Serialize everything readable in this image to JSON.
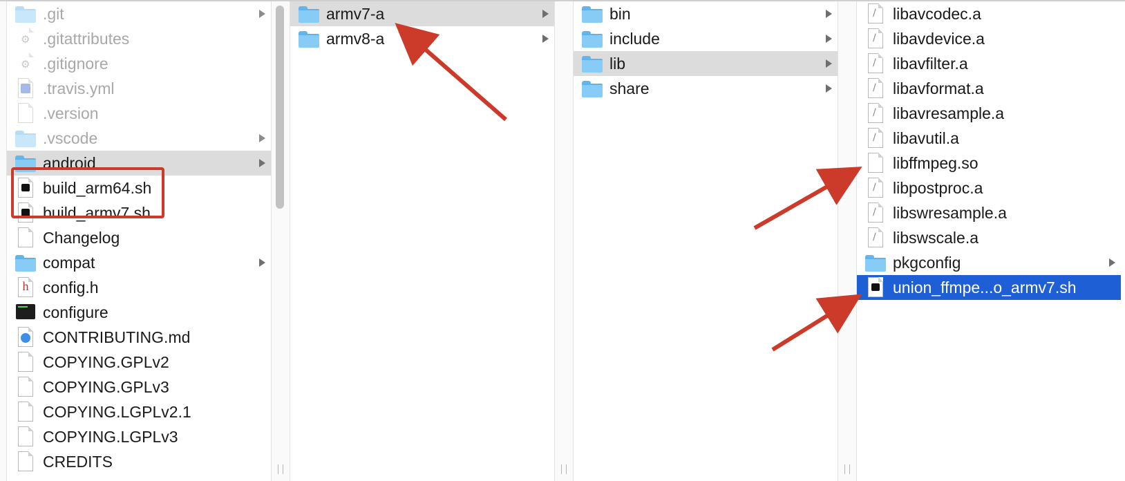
{
  "columns": [
    {
      "items": [
        {
          "label": ".git",
          "icon": "folder-icon",
          "has_children": true,
          "dim": true
        },
        {
          "label": ".gitattributes",
          "icon": "gear-file-icon",
          "has_children": false,
          "dim": true
        },
        {
          "label": ".gitignore",
          "icon": "gear-file-icon",
          "has_children": false,
          "dim": true
        },
        {
          "label": ".travis.yml",
          "icon": "yml-file-icon",
          "has_children": false,
          "dim": true
        },
        {
          "label": ".version",
          "icon": "document-icon",
          "has_children": false,
          "dim": true
        },
        {
          "label": ".vscode",
          "icon": "folder-icon",
          "has_children": true,
          "dim": true
        },
        {
          "label": "android",
          "icon": "folder-icon",
          "has_children": true,
          "selected": "gray"
        },
        {
          "label": "build_arm64.sh",
          "icon": "shell-script-icon",
          "has_children": false
        },
        {
          "label": "build_armv7.sh",
          "icon": "shell-script-icon",
          "has_children": false
        },
        {
          "label": "Changelog",
          "icon": "document-icon",
          "has_children": false
        },
        {
          "label": "compat",
          "icon": "folder-icon",
          "has_children": true
        },
        {
          "label": "config.h",
          "icon": "header-file-icon",
          "has_children": false
        },
        {
          "label": "configure",
          "icon": "terminal-exec-icon",
          "has_children": false
        },
        {
          "label": "CONTRIBUTING.md",
          "icon": "markdown-file-icon",
          "has_children": false
        },
        {
          "label": "COPYING.GPLv2",
          "icon": "document-icon",
          "has_children": false
        },
        {
          "label": "COPYING.GPLv3",
          "icon": "document-icon",
          "has_children": false
        },
        {
          "label": "COPYING.LGPLv2.1",
          "icon": "document-icon",
          "has_children": false
        },
        {
          "label": "COPYING.LGPLv3",
          "icon": "document-icon",
          "has_children": false
        },
        {
          "label": "CREDITS",
          "icon": "document-icon",
          "has_children": false
        }
      ]
    },
    {
      "items": [
        {
          "label": "armv7-a",
          "icon": "folder-icon",
          "has_children": true,
          "selected": "gray"
        },
        {
          "label": "armv8-a",
          "icon": "folder-icon",
          "has_children": true
        }
      ]
    },
    {
      "items": [
        {
          "label": "bin",
          "icon": "folder-icon",
          "has_children": true
        },
        {
          "label": "include",
          "icon": "folder-icon",
          "has_children": true
        },
        {
          "label": "lib",
          "icon": "folder-icon",
          "has_children": true,
          "selected": "gray"
        },
        {
          "label": "share",
          "icon": "folder-icon",
          "has_children": true
        }
      ]
    },
    {
      "items": [
        {
          "label": "libavcodec.a",
          "icon": "archive-file-icon",
          "has_children": false
        },
        {
          "label": "libavdevice.a",
          "icon": "archive-file-icon",
          "has_children": false
        },
        {
          "label": "libavfilter.a",
          "icon": "archive-file-icon",
          "has_children": false
        },
        {
          "label": "libavformat.a",
          "icon": "archive-file-icon",
          "has_children": false
        },
        {
          "label": "libavresample.a",
          "icon": "archive-file-icon",
          "has_children": false
        },
        {
          "label": "libavutil.a",
          "icon": "archive-file-icon",
          "has_children": false
        },
        {
          "label": "libffmpeg.so",
          "icon": "document-icon",
          "has_children": false
        },
        {
          "label": "libpostproc.a",
          "icon": "archive-file-icon",
          "has_children": false
        },
        {
          "label": "libswresample.a",
          "icon": "archive-file-icon",
          "has_children": false
        },
        {
          "label": "libswscale.a",
          "icon": "archive-file-icon",
          "has_children": false
        },
        {
          "label": "pkgconfig",
          "icon": "folder-icon",
          "has_children": true
        },
        {
          "label": "union_ffmpe...o_armv7.sh",
          "icon": "shell-script-icon",
          "has_children": false,
          "selected": "blue"
        }
      ]
    }
  ],
  "colors": {
    "selection_blue": "#1f5fd6",
    "selection_gray": "#dcdcdc",
    "annotation_red": "#cc3a2a",
    "folder_blue": "#86ccf6"
  },
  "annotations": [
    {
      "type": "highlight-box",
      "target": "build_arm64.sh, build_armv7.sh"
    },
    {
      "type": "arrow",
      "target": "armv7-a"
    },
    {
      "type": "arrow",
      "target": "libffmpeg.so"
    },
    {
      "type": "arrow",
      "target": "union_ffmpe...o_armv7.sh"
    }
  ]
}
